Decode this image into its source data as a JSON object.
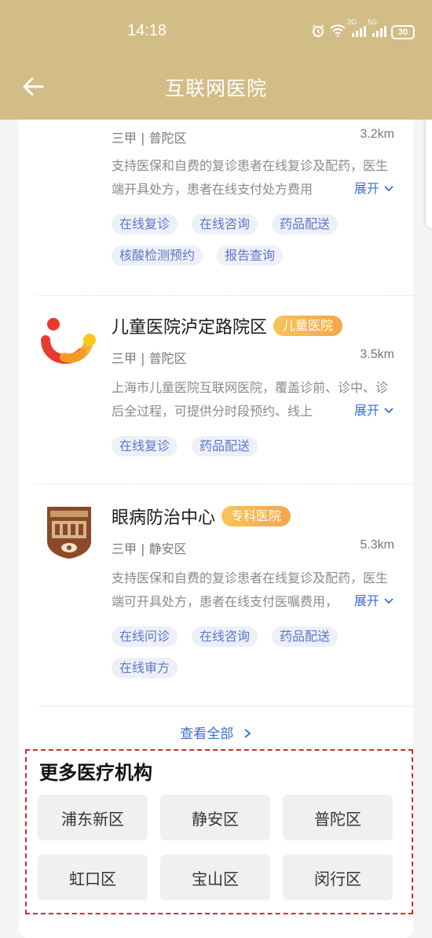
{
  "status": {
    "time": "14:18",
    "battery": "30",
    "net1": "2G",
    "net2": "5G"
  },
  "nav": {
    "title": "互联网医院"
  },
  "hospitals": [
    {
      "level_area": "三甲 | 普陀区",
      "distance": "3.2km",
      "desc": "支持医保和自费的复诊患者在线复诊及配药，医生端开具处方，患者在线支付处方费用",
      "tags": [
        "在线复诊",
        "在线咨询",
        "药品配送",
        "核酸检测预约",
        "报告查询"
      ]
    },
    {
      "name": "儿童医院泸定路院区",
      "badge": "儿童医院",
      "level_area": "三甲 | 普陀区",
      "distance": "3.5km",
      "desc": "上海市儿童医院互联网医院，覆盖诊前、诊中、诊后全过程，可提供分时段预约、线上",
      "tags": [
        "在线复诊",
        "药品配送"
      ]
    },
    {
      "name": "眼病防治中心",
      "badge": "专科医院",
      "level_area": "三甲 | 静安区",
      "distance": "5.3km",
      "desc": "支持医保和自费的复诊患者在线复诊及配药，医生端可开具处方，患者在线支付医嘱费用，",
      "tags": [
        "在线问诊",
        "在线咨询",
        "药品配送",
        "在线审方"
      ]
    }
  ],
  "expand_label": "展开",
  "view_all": "查看全部",
  "more": {
    "title": "更多医疗机构",
    "districts": [
      "浦东新区",
      "静安区",
      "普陀区",
      "虹口区",
      "宝山区",
      "闵行区"
    ]
  },
  "colors": {
    "header": "#d3bd87",
    "link": "#3a6fd1",
    "tag_bg": "#eef0f8",
    "badge": "#f3a74a",
    "highlight_border": "#d62b2b"
  }
}
